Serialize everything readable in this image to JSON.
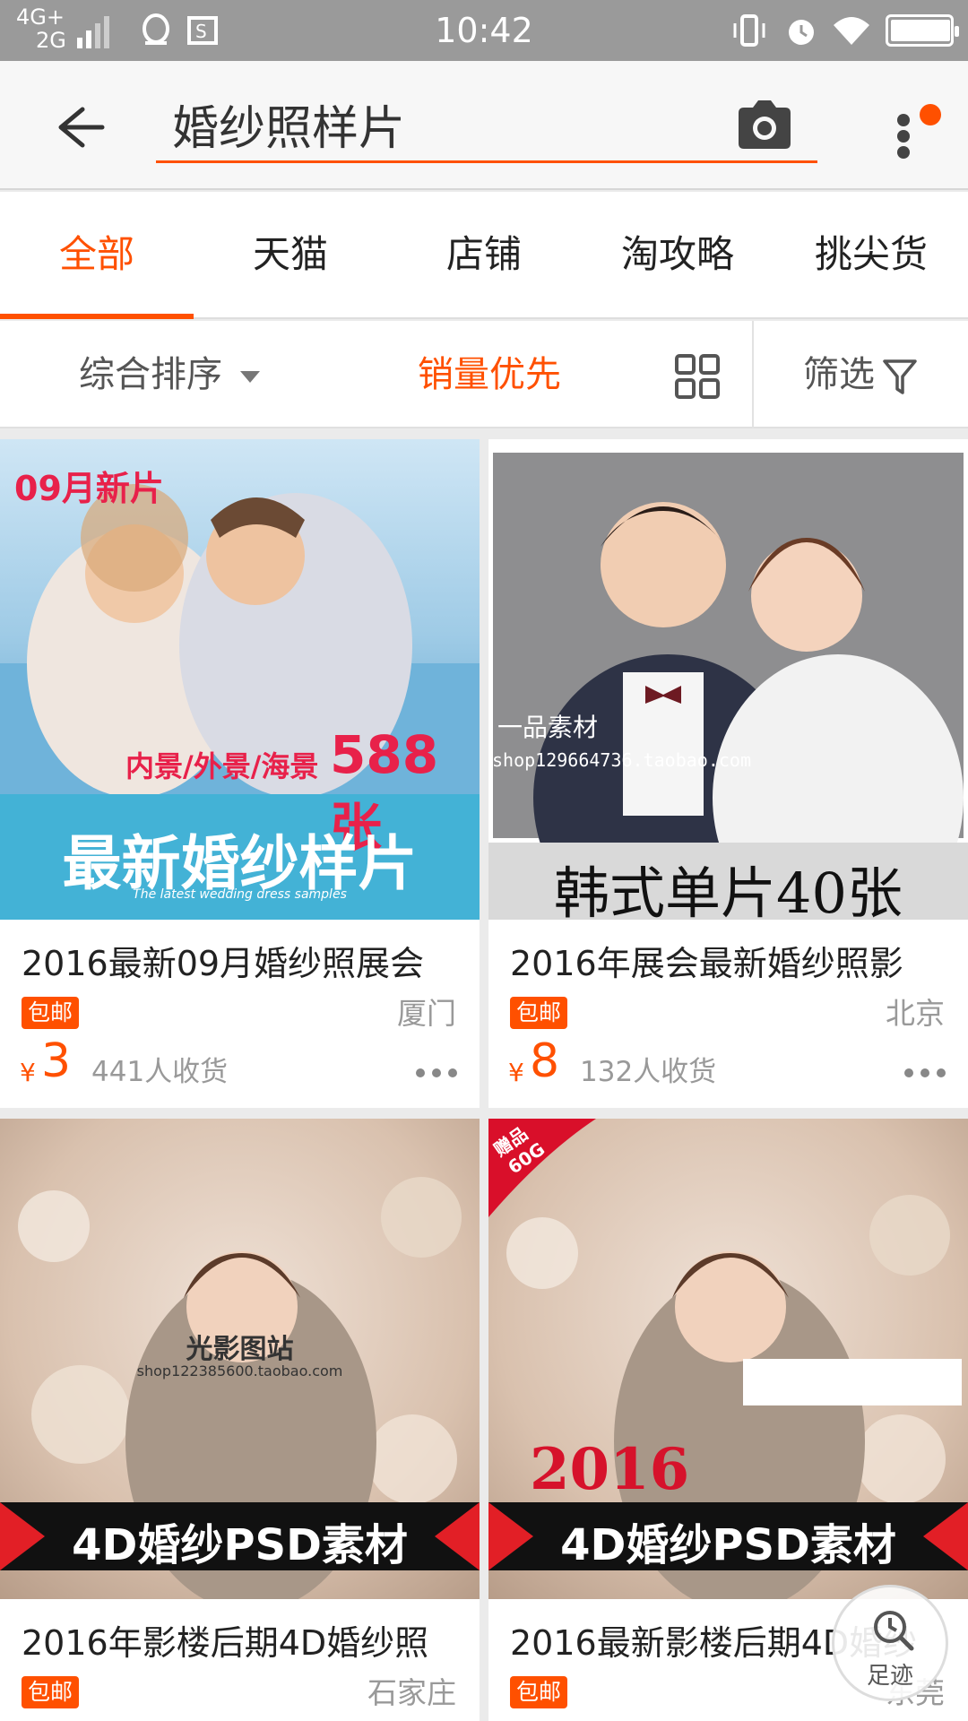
{
  "status_bar": {
    "network_top": "4G+",
    "network_bottom": "2G",
    "time": "10:42"
  },
  "header": {
    "search_value": "婚纱照样片"
  },
  "tabs": [
    {
      "label": "全部",
      "active": true
    },
    {
      "label": "天猫",
      "active": false
    },
    {
      "label": "店铺",
      "active": false
    },
    {
      "label": "淘攻略",
      "active": false
    },
    {
      "label": "挑尖货",
      "active": false
    }
  ],
  "sort_bar": {
    "default_sort": "综合排序",
    "sales_sort": "销量优先",
    "filter": "筛选"
  },
  "products": [
    {
      "title": "2016最新09月婚纱照展会",
      "badge": "包邮",
      "city": "厦门",
      "currency": "¥",
      "price": "3",
      "sold": "441人收货",
      "image": {
        "corner_tag": "09月新片",
        "scene_text": "内景/外景/海景",
        "count_text": "588张",
        "banner_text": "最新婚纱样片",
        "banner_sub": "The latest wedding dress samples"
      }
    },
    {
      "title": "2016年展会最新婚纱照影",
      "badge": "包邮",
      "city": "北京",
      "currency": "¥",
      "price": "8",
      "sold": "132人收货",
      "image": {
        "watermark": "一品素材",
        "shop_url": "shop129664736.taobao.com",
        "banner_text": "韩式单片40张"
      }
    },
    {
      "title": "2016年影楼后期4D婚纱照",
      "badge": "包邮",
      "city": "石家庄",
      "image": {
        "watermark": "光影图站",
        "shop_url": "shop122385600.taobao.com",
        "banner_text": "4D婚纱PSD素材"
      }
    },
    {
      "title": "2016最新影楼后期4D婚纱",
      "badge": "包邮",
      "city": "东莞",
      "image": {
        "corner_tag_line1": "赠品",
        "corner_tag_line2": "60G",
        "year_text": "2016",
        "banner_text": "4D婚纱PSD素材"
      }
    }
  ],
  "footprint": {
    "label": "足迹"
  },
  "colors": {
    "accent": "#ff5000",
    "status_bar": "#9a9a9a"
  }
}
